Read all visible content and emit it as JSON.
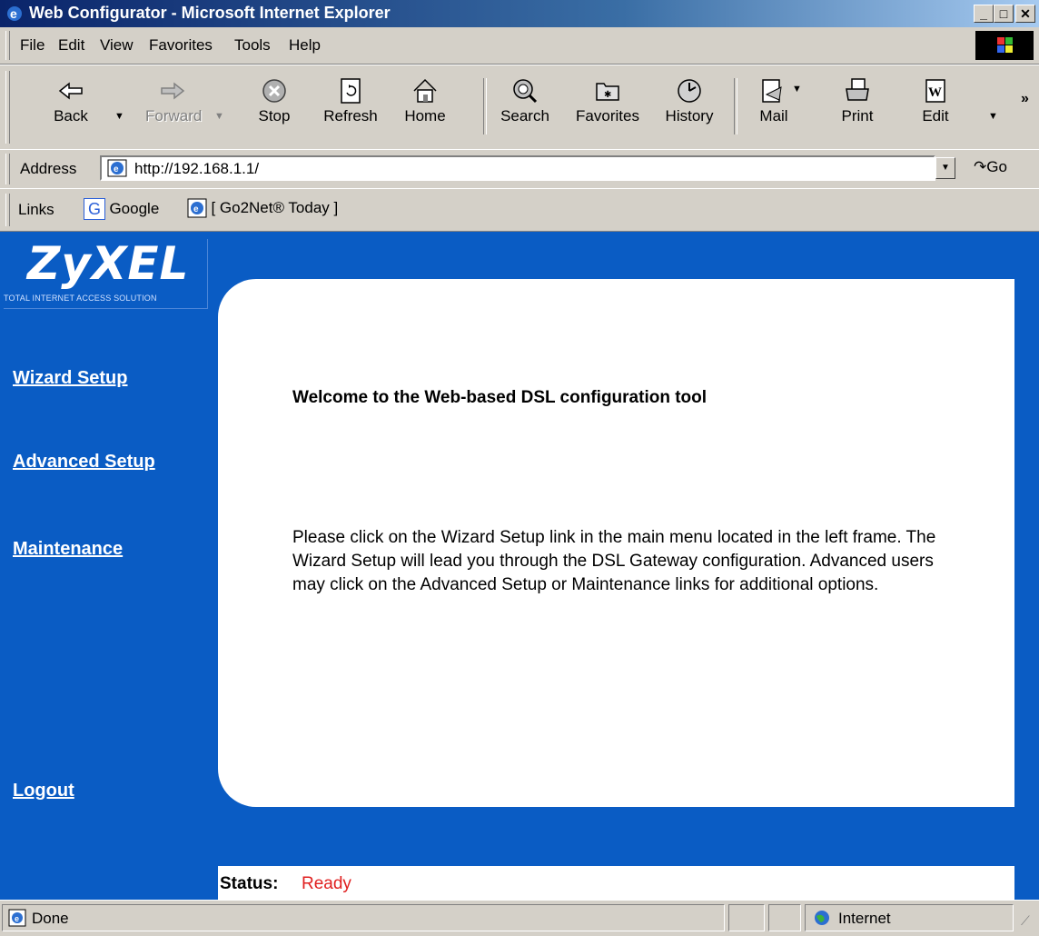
{
  "window": {
    "title": "Web Configurator - Microsoft Internet Explorer"
  },
  "menu": {
    "items": [
      {
        "label": "File"
      },
      {
        "label": "Edit"
      },
      {
        "label": "View"
      },
      {
        "label": "Favorites"
      },
      {
        "label": "Tools"
      },
      {
        "label": "Help"
      }
    ]
  },
  "toolbar": {
    "buttons": [
      {
        "label": "Back"
      },
      {
        "label": "Forward"
      },
      {
        "label": "Stop"
      },
      {
        "label": "Refresh"
      },
      {
        "label": "Home"
      },
      {
        "label": "Search"
      },
      {
        "label": "Favorites"
      },
      {
        "label": "History"
      },
      {
        "label": "Mail"
      },
      {
        "label": "Print"
      },
      {
        "label": "Edit"
      }
    ]
  },
  "address": {
    "label": "Address",
    "url": "http://192.168.1.1/",
    "go_label": "Go"
  },
  "links": {
    "label": "Links",
    "items": [
      {
        "label": "Google"
      },
      {
        "label": "[ Go2Net® Today ]"
      }
    ]
  },
  "brand": {
    "name": "ZyXEL",
    "tagline": "Total Internet Access Solution"
  },
  "nav": {
    "items": [
      {
        "label": "Wizard Setup"
      },
      {
        "label": "Advanced Setup"
      },
      {
        "label": "Maintenance"
      },
      {
        "label": "Logout"
      }
    ]
  },
  "main": {
    "heading": "Welcome to the Web-based DSL configuration tool",
    "paragraph": "Please click on the Wizard Setup link in the main menu located in the left frame. The Wizard Setup will lead you through the DSL Gateway configuration. Advanced users may click on the Advanced Setup or Maintenance links for additional options."
  },
  "status": {
    "label": "Status:",
    "value": "Ready"
  },
  "statusbar": {
    "text": "Done",
    "zone": "Internet"
  }
}
